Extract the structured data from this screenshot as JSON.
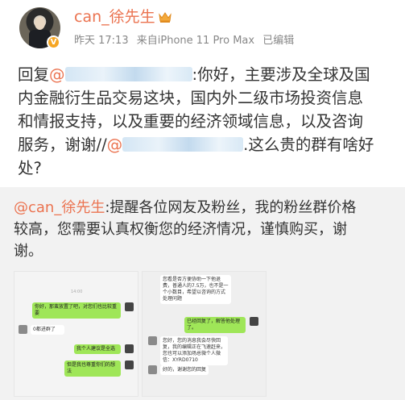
{
  "user": {
    "name": "can_徐先生",
    "verified_badge": "V",
    "crown_icon": "crown-icon",
    "accent_color": "#eb7350"
  },
  "meta": {
    "time": "昨天 17:13",
    "source": "来自iPhone 11 Pro Max",
    "edited": "已编辑"
  },
  "post": {
    "reply_prefix": "回复",
    "mention_at": "@",
    "line1_after": ":你好，主要涉及全球及国",
    "line2": "内金融衍生品交易这块，国内外二级市场投资信息",
    "line3": "和情报支持，以及重要的经济领域信息，以及咨询",
    "line4_before": "服务，谢谢//",
    "line4_mention_at": "@",
    "line4_after": ".这么贵的群有啥好",
    "line5": "处?"
  },
  "repost": {
    "mention": "@can_徐先生",
    "text_line1": ":提醒各位网友及粉丝，我的粉丝群价格",
    "text_line2": "较高，您需要认真权衡您的经济情况，谨慎购买，谢",
    "text_line3": "谢。"
  },
  "images": {
    "left": {
      "time": "14:00",
      "msg1": "你好，那蛮放置了吧，对您们也比较重要",
      "msg2": "0都进群了",
      "msg3": "我个人建议是全选",
      "msg4": "但是我也尊重你们的想法"
    },
    "right": {
      "msg1": "您看是否方便协助一下他退费，普通人的7.5万，也不是一个小数目，希望以咨询的方式处理问题",
      "msg2": "已经回复了，解答他处理了。",
      "msg3": "您好，您的消息我会尽快回复，我的编辑正在飞速赶来，您也可以添加场总微个人微信：XYRD0710",
      "msg4": "好的，谢谢您的回复"
    }
  }
}
